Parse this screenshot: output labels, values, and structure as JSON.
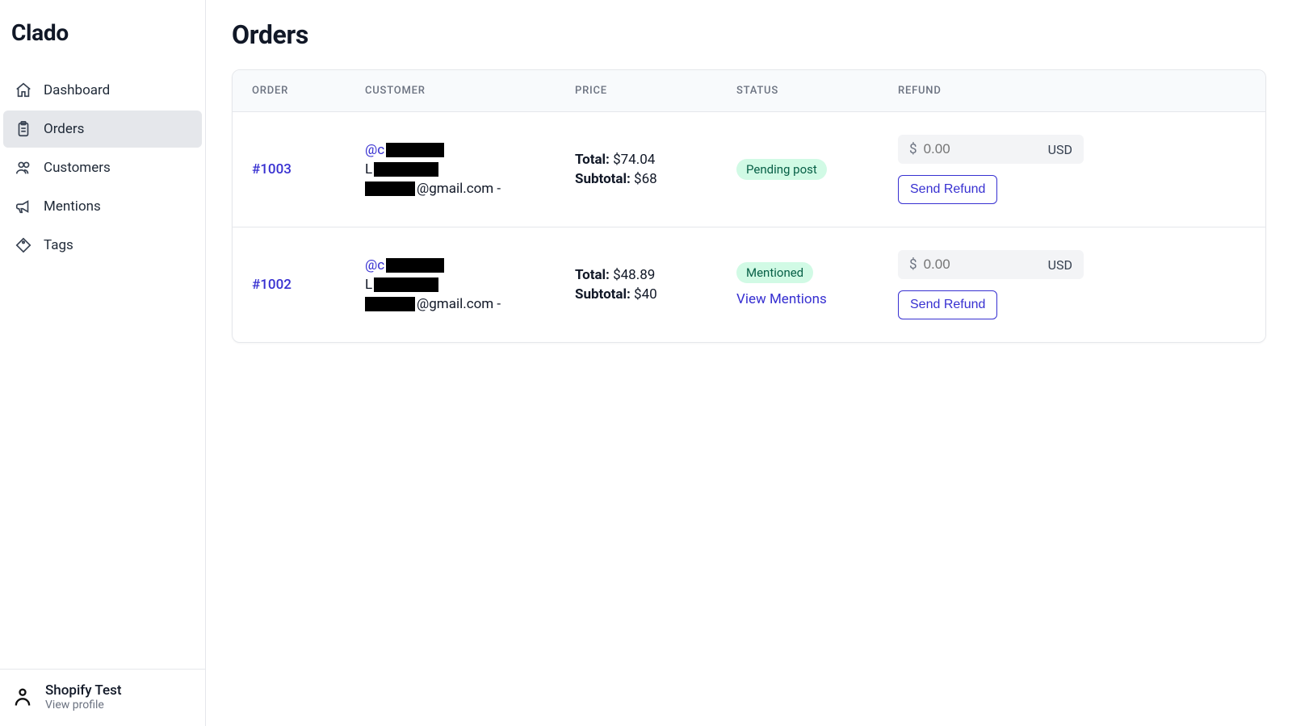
{
  "brand": "Clado",
  "sidebar": {
    "items": [
      {
        "label": "Dashboard",
        "icon": "home-icon",
        "active": false
      },
      {
        "label": "Orders",
        "icon": "clipboard-icon",
        "active": true
      },
      {
        "label": "Customers",
        "icon": "users-icon",
        "active": false
      },
      {
        "label": "Mentions",
        "icon": "megaphone-icon",
        "active": false
      },
      {
        "label": "Tags",
        "icon": "tag-icon",
        "active": false
      }
    ],
    "profile": {
      "name": "Shopify Test",
      "subtitle": "View profile"
    }
  },
  "page": {
    "title": "Orders",
    "columns": [
      "ORDER",
      "CUSTOMER",
      "PRICE",
      "STATUS",
      "REFUND"
    ],
    "rows": [
      {
        "order_id": "#1003",
        "customer": {
          "handle_prefix": "@c",
          "name_prefix": "L",
          "email_suffix": "@gmail.com -"
        },
        "price": {
          "total_label": "Total:",
          "total_value": "$74.04",
          "subtotal_label": "Subtotal:",
          "subtotal_value": "$68"
        },
        "status": {
          "badge": "Pending post",
          "view_mentions": null
        },
        "refund": {
          "placeholder": "0.00",
          "currency_symbol": "$",
          "currency": "USD",
          "button": "Send Refund"
        }
      },
      {
        "order_id": "#1002",
        "customer": {
          "handle_prefix": "@c",
          "name_prefix": "L",
          "email_suffix": "@gmail.com -"
        },
        "price": {
          "total_label": "Total:",
          "total_value": "$48.89",
          "subtotal_label": "Subtotal:",
          "subtotal_value": "$40"
        },
        "status": {
          "badge": "Mentioned",
          "view_mentions": "View Mentions"
        },
        "refund": {
          "placeholder": "0.00",
          "currency_symbol": "$",
          "currency": "USD",
          "button": "Send Refund"
        }
      }
    ]
  }
}
